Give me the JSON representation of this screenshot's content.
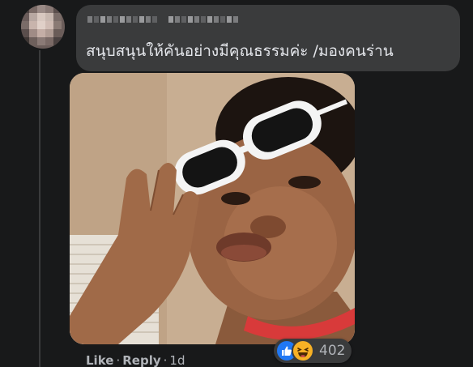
{
  "comment": {
    "author_name": "",
    "text": "สนุบสนุนให้คันอย่างมีคุณธรรมค่ะ /มองคนร่าน",
    "attachment": {
      "type": "photo",
      "alt": ""
    }
  },
  "actions": {
    "like_label": "Like",
    "separator": "·",
    "reply_label": "Reply",
    "timestamp": "1d"
  },
  "reactions": {
    "icons": [
      "like-icon",
      "haha-icon"
    ],
    "count": "402"
  },
  "colors": {
    "background": "#18191a",
    "bubble": "#3a3b3c",
    "text": "#e4e6eb",
    "muted": "#b0b3b8",
    "like_blue": "#2078f4",
    "haha_yellow": "#f7b125"
  }
}
